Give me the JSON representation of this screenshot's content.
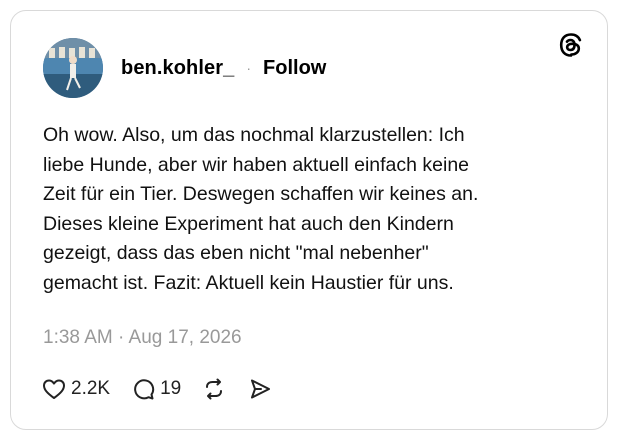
{
  "post": {
    "username": "ben.kohler_",
    "separator": "·",
    "follow_label": "Follow",
    "text": "Oh wow. Also, um das nochmal klarzustellen: Ich\nliebe Hunde, aber wir haben aktuell einfach keine\nZeit für ein Tier. Deswegen schaffen wir keines an.\nDieses kleine Experiment hat auch den Kindern\ngezeigt, dass das eben nicht \"mal nebenher\"\ngemacht ist. Fazit: Aktuell kein Haustier für uns.",
    "timestamp": "1:38 AM · Aug 17, 2026"
  },
  "actions": {
    "likes": "2.2K",
    "replies": "19",
    "like_icon": "heart-icon",
    "reply_icon": "comment-icon",
    "repost_icon": "repost-icon",
    "share_icon": "send-icon"
  },
  "brand": {
    "logo_icon": "threads-logo-icon"
  }
}
